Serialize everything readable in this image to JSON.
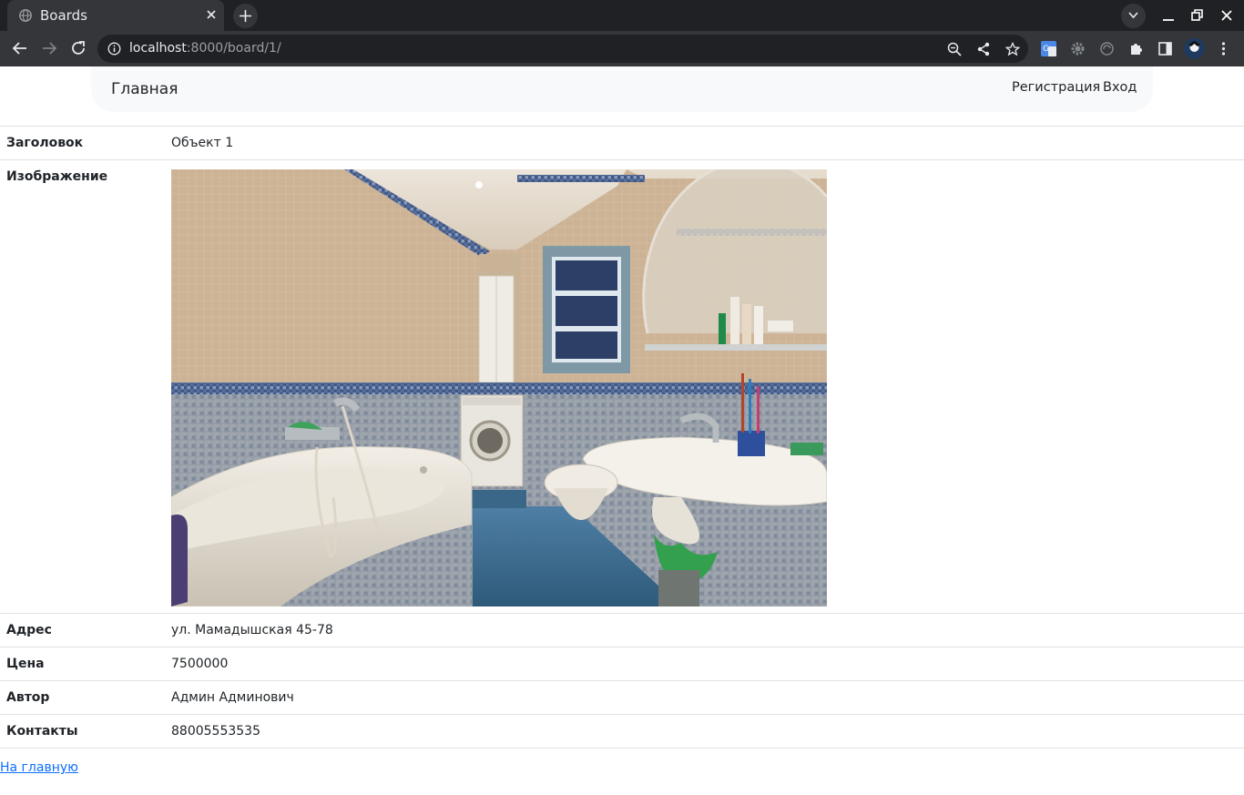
{
  "browser": {
    "tab_title": "Boards",
    "url_host": "localhost",
    "url_path": ":8000/board/1/"
  },
  "navbar": {
    "brand": "Главная",
    "register": "Регистрация",
    "login": "Вход"
  },
  "details": {
    "title_label": "Заголовок",
    "title_value": "Объект 1",
    "image_label": "Изображение",
    "address_label": "Адрес",
    "address_value": "ул. Мамадышская 45-78",
    "price_label": "Цена",
    "price_value": "7500000",
    "author_label": "Автор",
    "author_value": "Админ Админович",
    "contacts_label": "Контакты",
    "contacts_value": "88005553535"
  },
  "home_link": "На главную",
  "colors": {
    "link": "#0d6efd",
    "navbar_bg": "#f8f9fa",
    "chrome_dark": "#202124",
    "chrome_toolbar": "#35363a"
  }
}
